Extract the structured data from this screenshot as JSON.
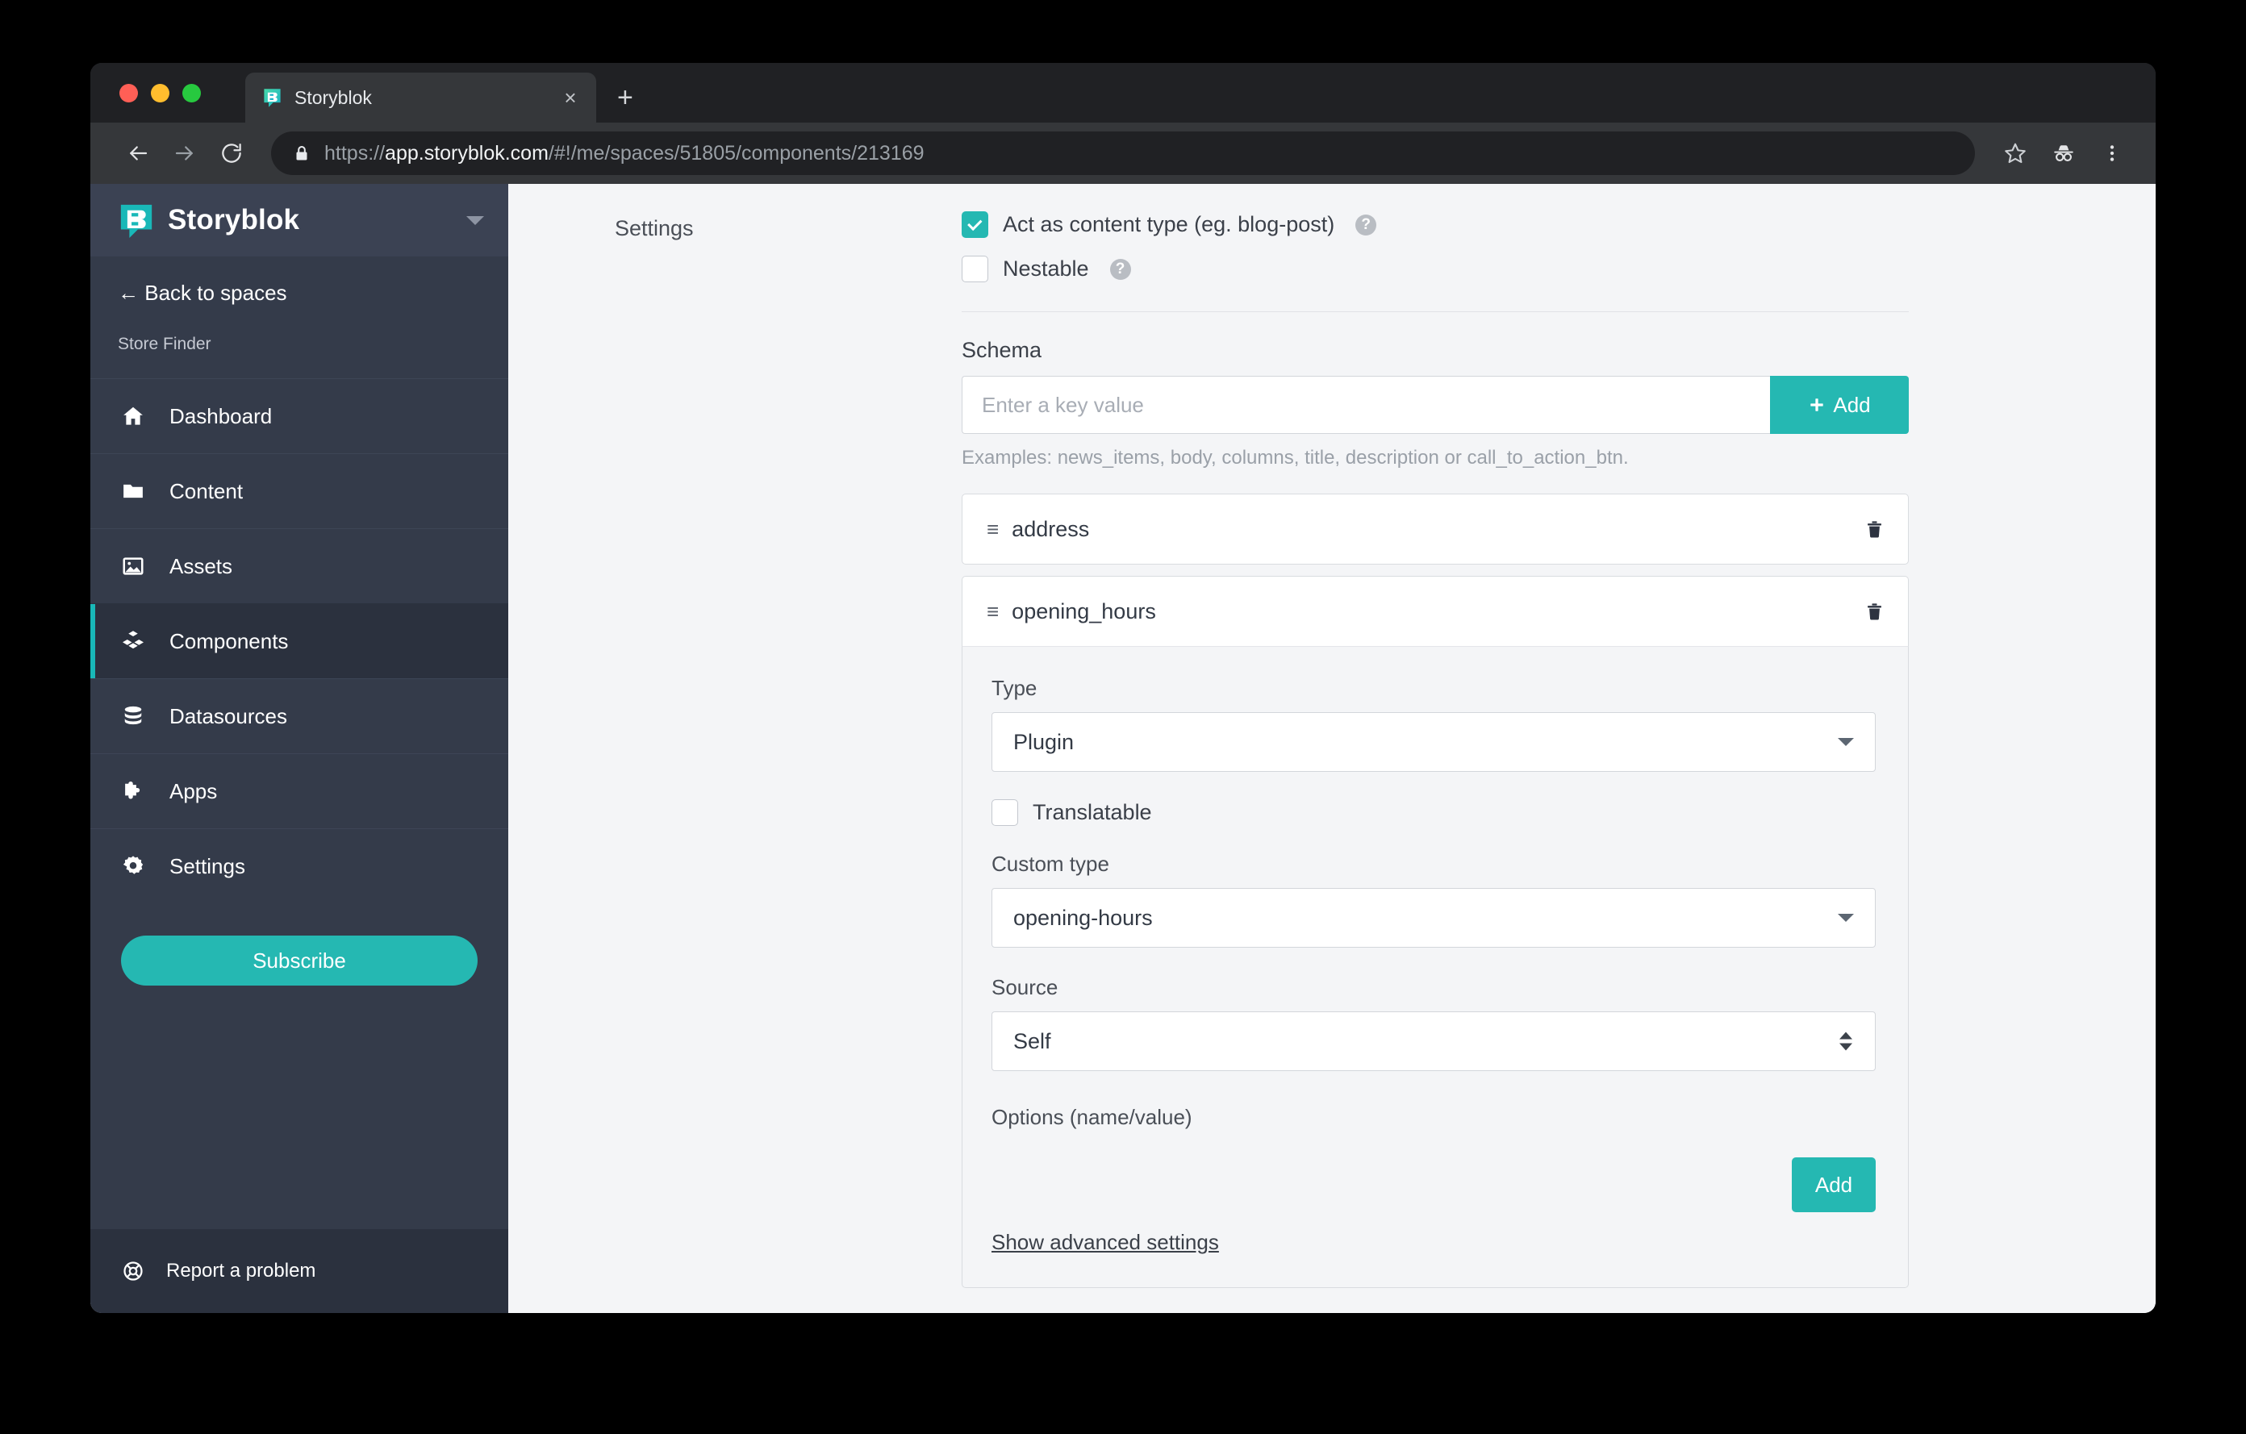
{
  "browser": {
    "tab": {
      "title": "Storyblok",
      "close_label": "×",
      "favicon": "storyblok-favicon"
    },
    "new_tab_label": "+",
    "nav": {
      "back": "back-arrow",
      "forward": "forward-arrow",
      "reload": "reload"
    },
    "url": {
      "scheme": "https://",
      "host": "app.storyblok.com",
      "path": "/#!/me/spaces/51805/components/213169",
      "full": "https://app.storyblok.com/#!/me/spaces/51805/components/213169"
    },
    "toolbar_icons": [
      "bookmark-star-icon",
      "incognito-icon",
      "browser-menu-icon"
    ]
  },
  "sidebar": {
    "brand": "Storyblok",
    "back_label": "← Back to spaces",
    "space_name": "Store Finder",
    "items": [
      {
        "label": "Dashboard",
        "icon": "home-icon",
        "active": false
      },
      {
        "label": "Content",
        "icon": "folder-icon",
        "active": false
      },
      {
        "label": "Assets",
        "icon": "image-icon",
        "active": false
      },
      {
        "label": "Components",
        "icon": "components-icon",
        "active": true
      },
      {
        "label": "Datasources",
        "icon": "database-icon",
        "active": false
      },
      {
        "label": "Apps",
        "icon": "puzzle-icon",
        "active": false
      },
      {
        "label": "Settings",
        "icon": "gear-icon",
        "active": false
      }
    ],
    "subscribe_label": "Subscribe",
    "report_label": "Report a problem",
    "report_icon": "lifebuoy-icon",
    "accent_color": "#25b8b2"
  },
  "main": {
    "nav_label": "Settings",
    "checkboxes": [
      {
        "label": "Act as content type (eg. blog-post)",
        "checked": true,
        "help": "?"
      },
      {
        "label": "Nestable",
        "checked": false,
        "help": "?"
      }
    ],
    "schema": {
      "title": "Schema",
      "input_placeholder": "Enter a key value",
      "input_value": "",
      "add_label": "Add",
      "hint": "Examples: news_items, body, columns, title, description or call_to_action_btn."
    },
    "fields": [
      {
        "key": "address",
        "expanded": false
      },
      {
        "key": "opening_hours",
        "expanded": true
      }
    ],
    "panel": {
      "type_label": "Type",
      "type_value": "Plugin",
      "translatable_label": "Translatable",
      "translatable_checked": false,
      "custom_type_label": "Custom type",
      "custom_type_value": "opening-hours",
      "source_label": "Source",
      "source_value": "Self",
      "options_label": "Options (name/value)",
      "options_add_label": "Add",
      "advanced_link": "Show advanced settings"
    }
  }
}
